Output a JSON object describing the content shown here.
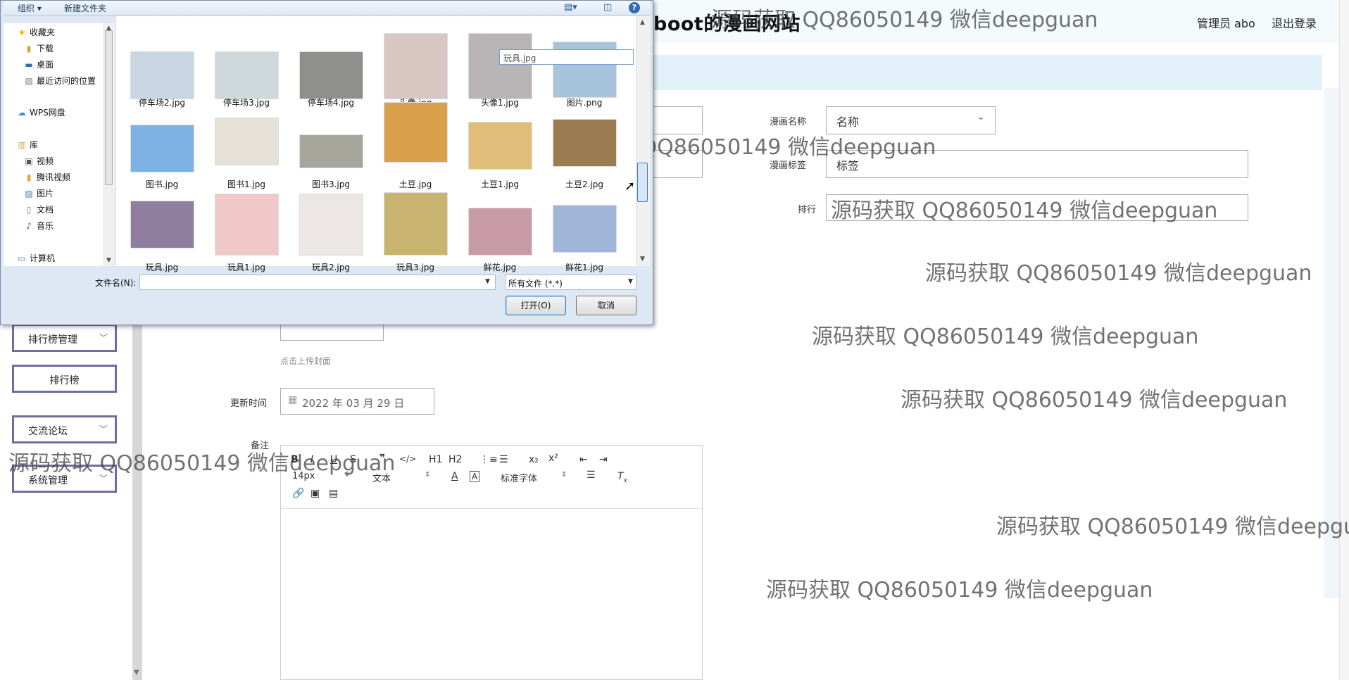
{
  "header": {
    "site_title": "boot的漫画网站",
    "user_label": "管理员 abo",
    "logout_label": "退出登录"
  },
  "sidebar": {
    "items": [
      {
        "label": "排行榜管理",
        "chevron": "﹀"
      },
      {
        "label": "排行榜",
        "chevron": ""
      },
      {
        "label": "交流论坛",
        "chevron": "﹀"
      },
      {
        "label": "系统管理",
        "chevron": "﹀"
      }
    ]
  },
  "form": {
    "name_label": "漫画名称",
    "name_value": "名称",
    "tag_label": "漫画标签",
    "tag_value": "标签",
    "rank_label": "排行",
    "cover_hint": "点击上传封面",
    "update_label": "更新时间",
    "update_value": "2022 年 03 月 29 日",
    "remark_label": "备注"
  },
  "editor": {
    "font_size": "14px",
    "block_type": "文本",
    "font_family": "标准字体",
    "buttons": [
      "B",
      "I",
      "U",
      "S",
      "❞",
      "</>",
      "H1",
      "H2",
      "⋮≡",
      "☰",
      "x₂",
      "x²",
      "⇤",
      "⇥"
    ]
  },
  "watermark": {
    "text": "源码获取 QQ86050149 微信deepguan",
    "text_partial": "源码获取 QQ86050149 微信deepgu"
  },
  "dialog": {
    "toolbar": {
      "organize": "组织 ▾",
      "new_folder": "新建文件夹"
    },
    "nav": {
      "favorites": "收藏夹",
      "downloads": "下载",
      "desktop": "桌面",
      "recent": "最近访问的位置",
      "wps": "WPS网盘",
      "library": "库",
      "videos": "视频",
      "tencent_video": "腾讯视频",
      "pictures": "图片",
      "documents": "文档",
      "music": "音乐",
      "computer": "计算机"
    },
    "files": [
      {
        "name": "停车场2.jpg",
        "color": "#c9d6e3"
      },
      {
        "name": "停车场3.jpg",
        "color": "#cfd9dd"
      },
      {
        "name": "停车场4.jpg",
        "color": "#8f8f8c"
      },
      {
        "name": "头像.jpg",
        "color": "#d8c7c3"
      },
      {
        "name": "头像1.jpg",
        "color": "#b9b4b6"
      },
      {
        "name": "图片.png",
        "color": "#a7c4dc"
      },
      {
        "name": "图书.jpg",
        "color": "#7fb2e4"
      },
      {
        "name": "图书1.jpg",
        "color": "#e6e1d6"
      },
      {
        "name": "图书3.jpg",
        "color": "#a5a59c"
      },
      {
        "name": "土豆.jpg",
        "color": "#d9a04c"
      },
      {
        "name": "土豆1.jpg",
        "color": "#e0bd79"
      },
      {
        "name": "土豆2.jpg",
        "color": "#9a7c50"
      },
      {
        "name": "玩具.jpg",
        "color": "#8f7ea0"
      },
      {
        "name": "玩具1.jpg",
        "color": "#f1c8c8"
      },
      {
        "name": "玩具2.jpg",
        "color": "#ece6e6"
      },
      {
        "name": "玩具3.jpg",
        "color": "#c8b46e"
      },
      {
        "name": "鲜花.jpg",
        "color": "#c99aa8"
      },
      {
        "name": "鲜花1.jpg",
        "color": "#9fb6d9"
      }
    ],
    "rename_value": "玩具.jpg",
    "filename_label": "文件名(N):",
    "filename_value": "",
    "filter_value": "所有文件 (*.*)",
    "open_label": "打开(O)",
    "cancel_label": "取消"
  }
}
